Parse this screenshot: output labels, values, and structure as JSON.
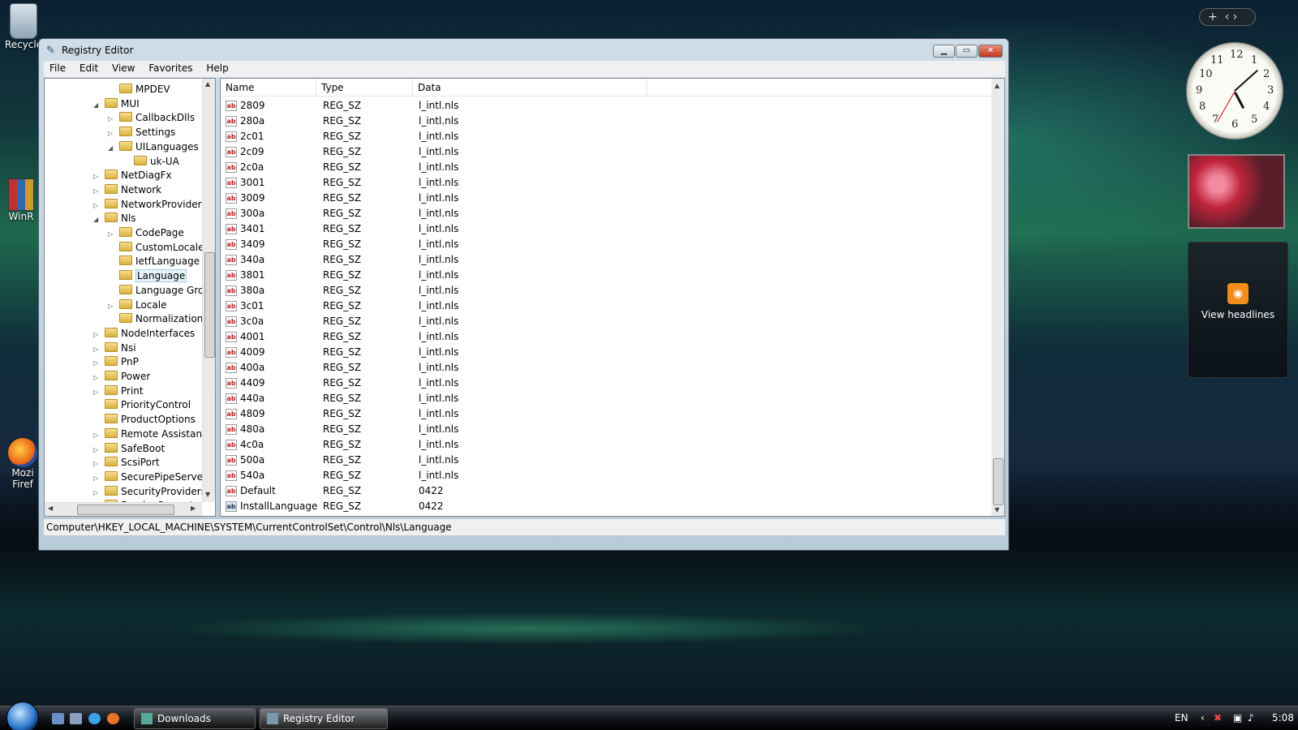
{
  "desktop": {
    "icons": [
      {
        "label": "Recycle"
      },
      {
        "label": "WinR"
      },
      {
        "label": "Mozi Firef"
      }
    ],
    "gadgets": {
      "clock_numbers": [
        "12",
        "1",
        "2",
        "3",
        "4",
        "5",
        "6",
        "7",
        "8",
        "9",
        "10",
        "11"
      ],
      "feed_label": "View headlines"
    }
  },
  "window": {
    "title": "Registry Editor",
    "menu": [
      "File",
      "Edit",
      "View",
      "Favorites",
      "Help"
    ],
    "status_path": "Computer\\HKEY_LOCAL_MACHINE\\SYSTEM\\CurrentControlSet\\Control\\Nls\\Language"
  },
  "tree": [
    {
      "label": "MPDEV",
      "expander": ""
    },
    {
      "label": "MUI",
      "expander": "◢"
    },
    {
      "label": "CallbackDlls",
      "expander": "▷"
    },
    {
      "label": "Settings",
      "expander": "▷"
    },
    {
      "label": "UILanguages",
      "expander": "◢"
    },
    {
      "label": "uk-UA",
      "expander": ""
    },
    {
      "label": "NetDiagFx",
      "expander": "▷"
    },
    {
      "label": "Network",
      "expander": "▷"
    },
    {
      "label": "NetworkProvider",
      "expander": "▷"
    },
    {
      "label": "Nls",
      "expander": "◢"
    },
    {
      "label": "CodePage",
      "expander": "▷"
    },
    {
      "label": "CustomLocale",
      "expander": ""
    },
    {
      "label": "IetfLanguage",
      "expander": ""
    },
    {
      "label": "Language",
      "expander": "",
      "selected": true
    },
    {
      "label": "Language Gro",
      "expander": ""
    },
    {
      "label": "Locale",
      "expander": "▷"
    },
    {
      "label": "Normalization",
      "expander": ""
    },
    {
      "label": "NodeInterfaces",
      "expander": "▷"
    },
    {
      "label": "Nsi",
      "expander": "▷"
    },
    {
      "label": "PnP",
      "expander": "▷"
    },
    {
      "label": "Power",
      "expander": "▷"
    },
    {
      "label": "Print",
      "expander": "▷"
    },
    {
      "label": "PriorityControl",
      "expander": ""
    },
    {
      "label": "ProductOptions",
      "expander": ""
    },
    {
      "label": "Remote Assistanc",
      "expander": "▷"
    },
    {
      "label": "SafeBoot",
      "expander": "▷"
    },
    {
      "label": "ScsiPort",
      "expander": "▷"
    },
    {
      "label": "SecurePipeServers",
      "expander": "▷"
    },
    {
      "label": "SecurityProviders",
      "expander": "▷"
    },
    {
      "label": "ServiceCurrent",
      "expander": ""
    }
  ],
  "list": {
    "columns": [
      "Name",
      "Type",
      "Data"
    ],
    "rows": [
      {
        "name": "2809",
        "type": "REG_SZ",
        "data": "l_intl.nls"
      },
      {
        "name": "280a",
        "type": "REG_SZ",
        "data": "l_intl.nls"
      },
      {
        "name": "2c01",
        "type": "REG_SZ",
        "data": "l_intl.nls"
      },
      {
        "name": "2c09",
        "type": "REG_SZ",
        "data": "l_intl.nls"
      },
      {
        "name": "2c0a",
        "type": "REG_SZ",
        "data": "l_intl.nls"
      },
      {
        "name": "3001",
        "type": "REG_SZ",
        "data": "l_intl.nls"
      },
      {
        "name": "3009",
        "type": "REG_SZ",
        "data": "l_intl.nls"
      },
      {
        "name": "300a",
        "type": "REG_SZ",
        "data": "l_intl.nls"
      },
      {
        "name": "3401",
        "type": "REG_SZ",
        "data": "l_intl.nls"
      },
      {
        "name": "3409",
        "type": "REG_SZ",
        "data": "l_intl.nls"
      },
      {
        "name": "340a",
        "type": "REG_SZ",
        "data": "l_intl.nls"
      },
      {
        "name": "3801",
        "type": "REG_SZ",
        "data": "l_intl.nls"
      },
      {
        "name": "380a",
        "type": "REG_SZ",
        "data": "l_intl.nls"
      },
      {
        "name": "3c01",
        "type": "REG_SZ",
        "data": "l_intl.nls"
      },
      {
        "name": "3c0a",
        "type": "REG_SZ",
        "data": "l_intl.nls"
      },
      {
        "name": "4001",
        "type": "REG_SZ",
        "data": "l_intl.nls"
      },
      {
        "name": "4009",
        "type": "REG_SZ",
        "data": "l_intl.nls"
      },
      {
        "name": "400a",
        "type": "REG_SZ",
        "data": "l_intl.nls"
      },
      {
        "name": "4409",
        "type": "REG_SZ",
        "data": "l_intl.nls"
      },
      {
        "name": "440a",
        "type": "REG_SZ",
        "data": "l_intl.nls"
      },
      {
        "name": "4809",
        "type": "REG_SZ",
        "data": "l_intl.nls"
      },
      {
        "name": "480a",
        "type": "REG_SZ",
        "data": "l_intl.nls"
      },
      {
        "name": "4c0a",
        "type": "REG_SZ",
        "data": "l_intl.nls"
      },
      {
        "name": "500a",
        "type": "REG_SZ",
        "data": "l_intl.nls"
      },
      {
        "name": "540a",
        "type": "REG_SZ",
        "data": "l_intl.nls"
      },
      {
        "name": "Default",
        "type": "REG_SZ",
        "data": "0422"
      },
      {
        "name": "InstallLanguage",
        "type": "REG_SZ",
        "data": "0422"
      }
    ]
  },
  "taskbar": {
    "buttons": [
      "Downloads",
      "Registry Editor"
    ],
    "language": "EN",
    "time": "5:08"
  },
  "colors": {
    "accent": "#2b74c9",
    "selection": "#e5f3fb",
    "close_button": "#c3361c"
  }
}
